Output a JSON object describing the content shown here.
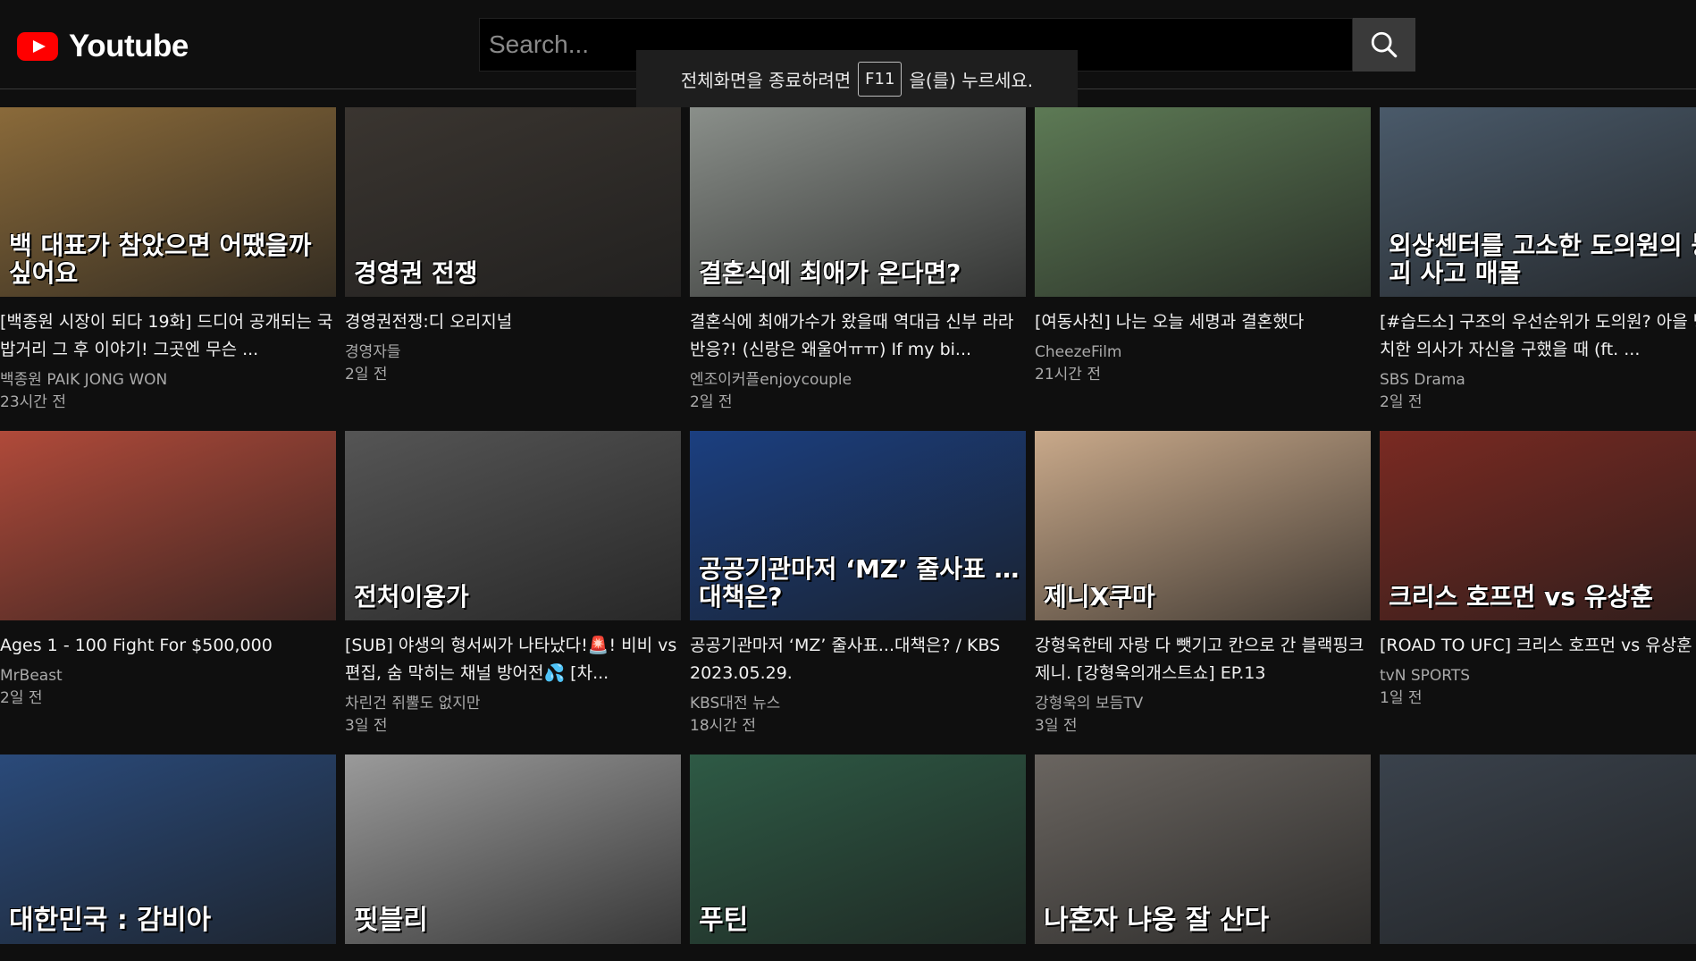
{
  "app": {
    "logo_text": "Youtube"
  },
  "search": {
    "placeholder": "Search..."
  },
  "toast": {
    "before": "전체화면을 종료하려면",
    "key": "F11",
    "after": "을(를) 누르세요."
  },
  "colors": {
    "brand": "#ff0000",
    "background": "#0f0f0f"
  },
  "videos": [
    {
      "title": "[백종원 시장이 되다 19화] 드디어 공개되는 국밥거리 그 후 이야기! 그곳엔 무슨 ...",
      "channel": "백종원 PAIK JONG WON",
      "age": "23시간 전",
      "thumb_text": "백 대표가 참았으면 어땠을까 싶어요",
      "thumb_bg": "#8a6a3a"
    },
    {
      "title": "경영권전쟁:디 오리지널",
      "channel": "경영자들",
      "age": "2일 전",
      "thumb_text": "경영권 전쟁",
      "thumb_bg": "#3a3530"
    },
    {
      "title": "결혼식에 최애가수가 왔을때 역대급 신부 라라반응?! (신랑은 왜울어ㅠㅠ) If my bi...",
      "channel": "엔조이커플enjoycouple",
      "age": "2일 전",
      "thumb_text": "결혼식에 최애가 온다면?",
      "thumb_bg": "#8a8f8a"
    },
    {
      "title": "[여동사친] 나는 오늘 세명과 결혼했다",
      "channel": "CheezeFilm",
      "age": "21시간 전",
      "thumb_text": "",
      "thumb_bg": "#5d7a55"
    },
    {
      "title": "[#습드소] 구조의 우선순위가 도의원? 아을 방치한 의사가 자신을 구했을 때 (ft. ...",
      "channel": "SBS Drama",
      "age": "2일 전",
      "thumb_text": "외상센터를 고소한 도의원의 붕괴 사고 매몰",
      "thumb_bg": "#4a5a6a"
    },
    {
      "title": "Ages 1 - 100 Fight For $500,000",
      "channel": "MrBeast",
      "age": "2일 전",
      "thumb_text": "",
      "thumb_bg": "#b04a3a"
    },
    {
      "title": "[SUB] 야생의 형서씨가 나타났다!🚨! 비비 vs 편집, 숨 막히는 채널 방어전💦 [차...",
      "channel": "차린건 쥐뿔도 없지만",
      "age": "3일 전",
      "thumb_text": "전처이용가",
      "thumb_bg": "#555555"
    },
    {
      "title": "공공기관마저 ‘MZ’ 줄사표...대책은? / KBS 2023.05.29.",
      "channel": "KBS대전 뉴스",
      "age": "18시간 전",
      "thumb_text": "공공기관마저 ‘MZ’ 줄사표 …대책은?",
      "thumb_bg": "#1b3f80"
    },
    {
      "title": "강형욱한테 자랑 다 뺏기고 칸으로 간 블랙핑크 제니. [강형욱의개스트쇼] EP.13",
      "channel": "강형욱의 보듬TV",
      "age": "3일 전",
      "thumb_text": "제니X쿠마",
      "thumb_bg": "#c9a98a"
    },
    {
      "title": "[ROAD TO UFC] 크리스 호프먼 vs 유상훈",
      "channel": "tvN SPORTS",
      "age": "1일 전",
      "thumb_text": "크리스 호프먼 vs 유상훈",
      "thumb_bg": "#7a2a22"
    },
    {
      "title": "",
      "channel": "",
      "age": "",
      "thumb_text": "대한민국 : 감비아",
      "thumb_bg": "#2a4a7a"
    },
    {
      "title": "",
      "channel": "",
      "age": "",
      "thumb_text": "핏블리",
      "thumb_bg": "#9a9a9a"
    },
    {
      "title": "",
      "channel": "",
      "age": "",
      "thumb_text": "푸틴",
      "thumb_bg": "#2e5a45"
    },
    {
      "title": "",
      "channel": "",
      "age": "",
      "thumb_text": "나혼자 냐옹 잘 산다",
      "thumb_bg": "#6a6560"
    },
    {
      "title": "",
      "channel": "",
      "age": "",
      "thumb_text": "",
      "thumb_bg": "#3a424c"
    }
  ]
}
